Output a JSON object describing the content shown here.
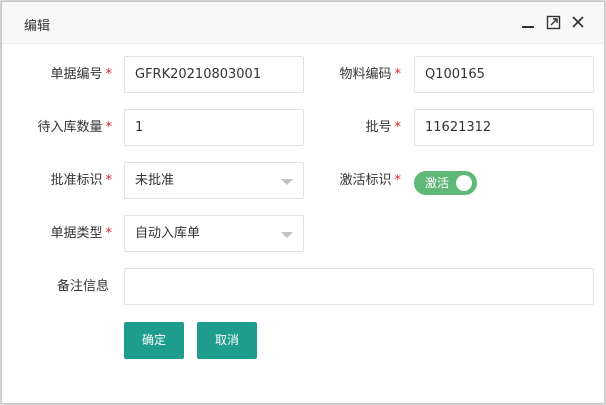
{
  "dialog": {
    "title": "编辑",
    "icons": [
      "minimize-icon",
      "maximize-icon",
      "close-icon"
    ]
  },
  "form": {
    "doc_no": {
      "label": "单据编号",
      "required_mark": "*",
      "value": "GFRK20210803001"
    },
    "material_code": {
      "label": "物料编码",
      "required_mark": "*",
      "value": "Q100165"
    },
    "pending_qty": {
      "label": "待入库数量",
      "required_mark": "*",
      "value": "1"
    },
    "batch_no": {
      "label": "批号",
      "required_mark": "*",
      "value": "11621312"
    },
    "approval_flag": {
      "label": "批准标识",
      "required_mark": "*",
      "value": "未批准"
    },
    "active_flag": {
      "label": "激活标识",
      "required_mark": "*",
      "value": "激活",
      "on": true
    },
    "doc_type": {
      "label": "单据类型",
      "required_mark": "*",
      "value": "自动入库单"
    },
    "remarks": {
      "label": "备注信息",
      "value": ""
    }
  },
  "buttons": {
    "confirm": "确定",
    "cancel": "取消"
  },
  "colors": {
    "primary": "#1e9c8c",
    "toggle_on": "#5fb878",
    "required": "#e02020"
  }
}
